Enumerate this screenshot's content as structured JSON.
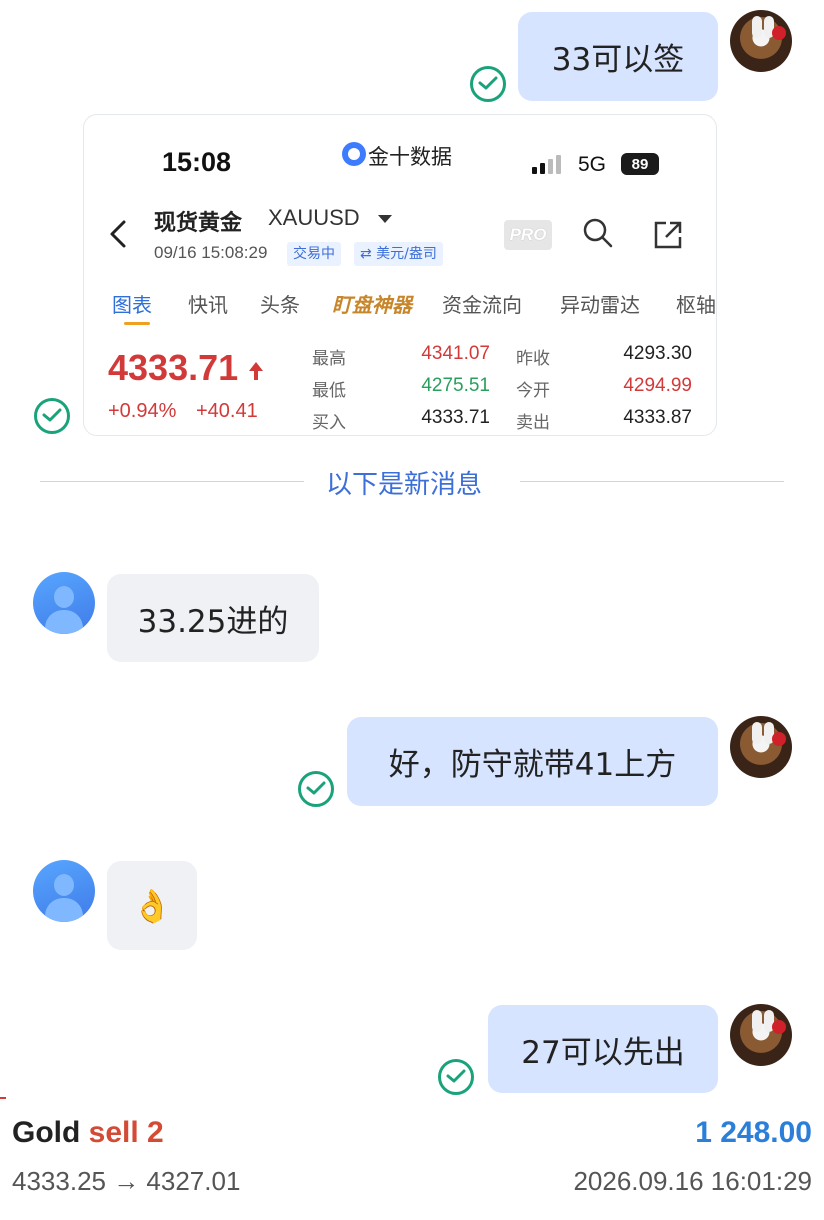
{
  "messages": {
    "m1": "33可以签",
    "m2": "33.25进的",
    "m3": "好，防守就带41上方",
    "m4": "👌",
    "m5": "27可以先出"
  },
  "quote_card": {
    "status_time": "15:08",
    "app_name": "金十数据",
    "network": "5G",
    "battery": "89",
    "title": "现货黄金",
    "symbol": "XAUUSD",
    "datetime": "09/16 15:08:29",
    "status_tag": "交易中",
    "currency_tag": "⇄ 美元/盎司",
    "pro_label": "PRO",
    "tabs": [
      "图表",
      "快讯",
      "头条",
      "盯盘神器",
      "资金流向",
      "异动雷达",
      "枢轴"
    ],
    "price": "4333.71",
    "change_pct": "+0.94%",
    "change_abs": "+40.41",
    "stats": {
      "high_label": "最高",
      "high": "4341.07",
      "low_label": "最低",
      "low": "4275.51",
      "bid_label": "买入",
      "bid": "4333.71",
      "prev_close_label": "昨收",
      "prev_close": "4293.30",
      "open_label": "今开",
      "open": "4294.99",
      "ask_label": "卖出",
      "ask": "4333.87"
    }
  },
  "divider_text": "以下是新消息",
  "trade": {
    "asset": "Gold",
    "side": "sell 2",
    "profit": "1 248.00",
    "price_path": "4333.25 → 4327.01",
    "timestamp": "2026.09.16 16:01:29"
  },
  "colors": {
    "outgoing_bubble": "#d6e4ff",
    "incoming_bubble": "#eff1f4",
    "read_check": "#1aa37b",
    "price_up": "#d23a3a",
    "price_down": "#28a05c",
    "profit": "#2b7fd9"
  }
}
